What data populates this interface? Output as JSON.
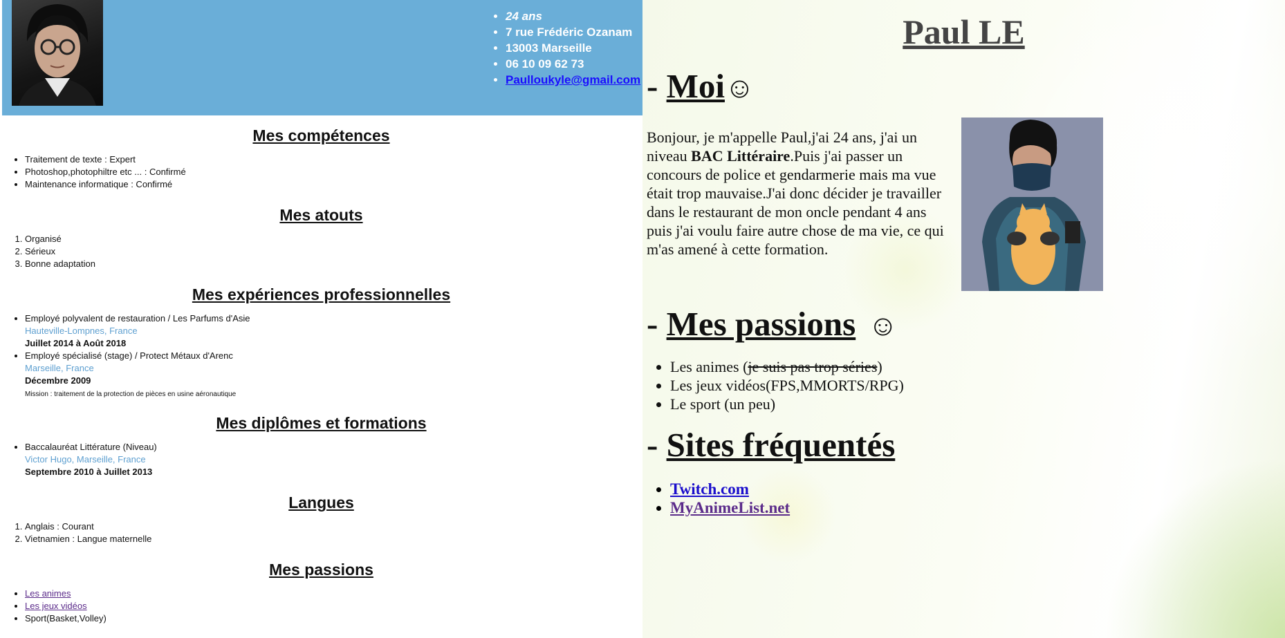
{
  "contact": {
    "age": "24 ans",
    "street": "7 rue Frédéric Ozanam",
    "city": "13003 Marseille",
    "phone": "06 10 09 62 73",
    "email": "Paulloukyle@gmail.com"
  },
  "competences": {
    "title": "Mes compétences",
    "items": [
      "Traitement de texte : Expert",
      "Photoshop,photophiltre etc ... : Confirmé",
      "Maintenance informatique : Confirmé"
    ]
  },
  "atouts": {
    "title": "Mes atouts",
    "items": [
      "Organisé",
      "Sérieux",
      "Bonne adaptation"
    ]
  },
  "experiences": {
    "title": "Mes expériences professionnelles",
    "items": [
      {
        "role": "Employé polyvalent de restauration / Les Parfums d'Asie",
        "place": "Hauteville-Lompnes, France",
        "date": "Juillet 2014 à Août 2018",
        "mission": ""
      },
      {
        "role": "Employé spécialisé (stage) / Protect Métaux d'Arenc",
        "place": "Marseille, France",
        "date": "Décembre 2009",
        "mission": "Mission : traitement de la protection de pièces en usine aéronautique"
      }
    ]
  },
  "diplomes": {
    "title": "Mes diplômes et formations",
    "items": [
      {
        "name": "Baccalauréat Littérature (Niveau)",
        "place": "Victor Hugo, Marseille, France",
        "date": "Septembre 2010 à Juillet 2013"
      }
    ]
  },
  "langues": {
    "title": "Langues",
    "items": [
      "Anglais : Courant",
      "Vietnamien : Langue maternelle"
    ]
  },
  "passions_left": {
    "title": "Mes passions",
    "items": [
      {
        "text": "Les animes",
        "link": true
      },
      {
        "text": "Les jeux vidéos",
        "link": true
      },
      {
        "text": "Sport(Basket,Volley)",
        "link": false
      }
    ]
  },
  "right": {
    "name": "Paul LE",
    "moi": {
      "prefix": "- ",
      "title": "Moi",
      "smile": "☺",
      "bio_1": "Bonjour, je m'appelle Paul,j'ai 24 ans, j'ai un niveau ",
      "bio_bold": "BAC Littéraire",
      "bio_2": ".Puis j'ai passer un concours de police et gendarmerie mais ma vue était trop mauvaise.J'ai donc décider je travailler dans le restaurant de mon oncle pendant 4 ans puis j'ai voulu faire autre chose de ma vie, ce qui m'as amené à cette formation."
    },
    "passions": {
      "prefix": "- ",
      "title": "Mes passions",
      "smile": "☺",
      "item1_a": "Les animes (",
      "item1_strike": "je suis pas trop séries",
      "item1_b": ")",
      "item2": "Les jeux vidéos(FPS,MMORTS/RPG)",
      "item3": "Le sport (un peu)"
    },
    "sites": {
      "prefix": "- ",
      "title": "Sites fréquentés",
      "items": [
        "Twitch.com",
        "MyAnimeList.net"
      ]
    }
  }
}
